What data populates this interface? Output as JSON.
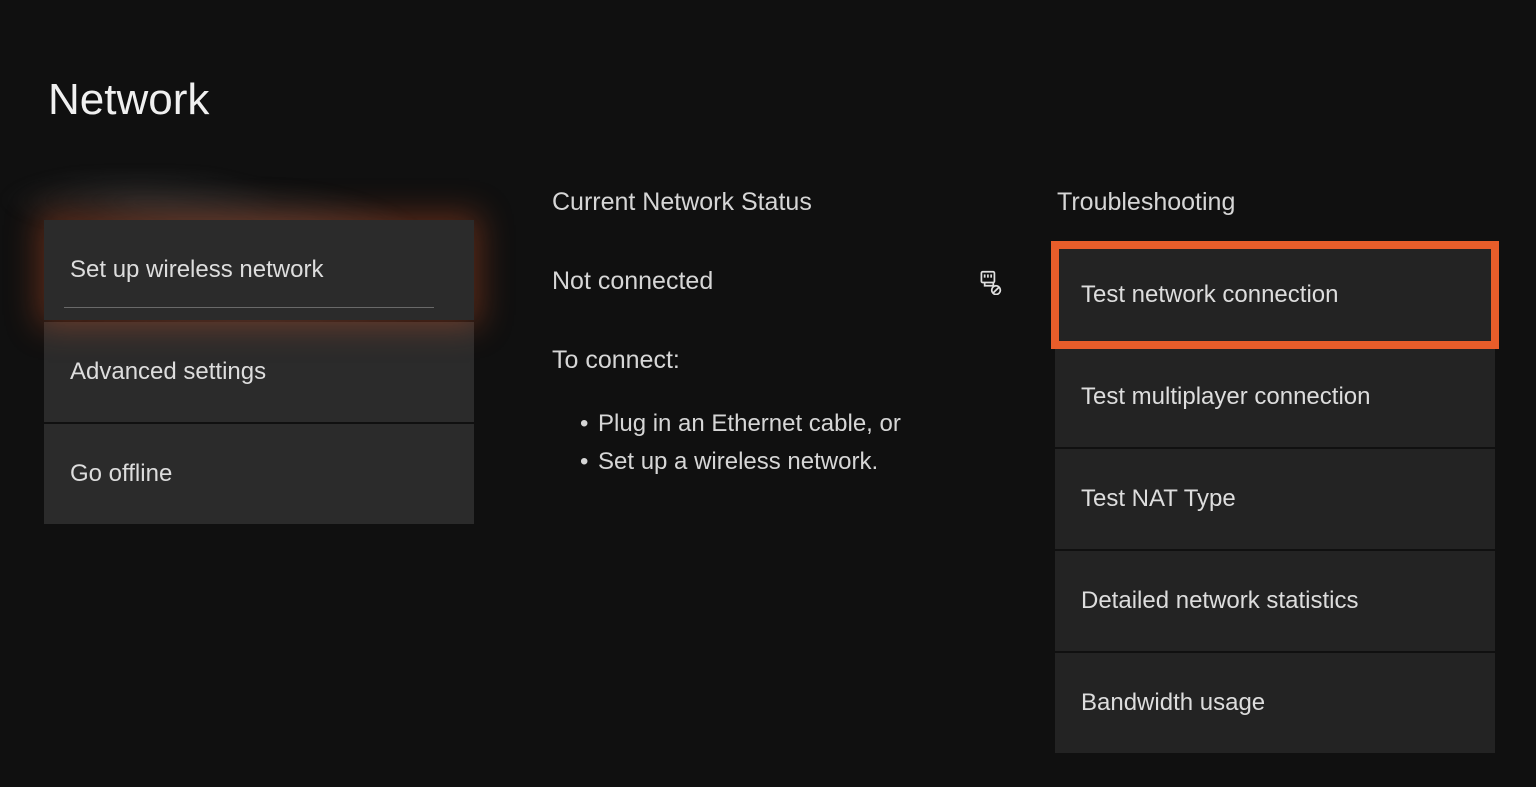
{
  "title": "Network",
  "left": {
    "items": [
      {
        "label": "Set up wireless network"
      },
      {
        "label": "Advanced settings"
      },
      {
        "label": "Go offline"
      }
    ]
  },
  "status": {
    "heading": "Current Network Status",
    "value": "Not connected",
    "connect_heading": "To connect:",
    "bullets": [
      "Plug in an Ethernet cable, or",
      "Set up a wireless network."
    ]
  },
  "right": {
    "heading": "Troubleshooting",
    "items": [
      {
        "label": "Test network connection"
      },
      {
        "label": "Test multiplayer connection"
      },
      {
        "label": "Test NAT Type"
      },
      {
        "label": "Detailed network statistics"
      },
      {
        "label": "Bandwidth usage"
      }
    ]
  }
}
